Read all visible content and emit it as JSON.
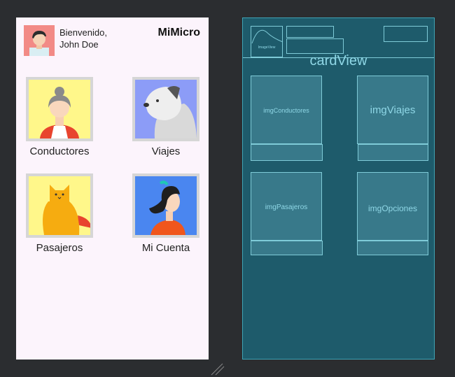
{
  "header": {
    "greeting_line1": "Bienvenido,",
    "greeting_line2": "John Doe",
    "app_title": "MiMicro"
  },
  "tiles": [
    {
      "label": "Conductores",
      "icon": "grandma-icon"
    },
    {
      "label": "Viajes",
      "icon": "dog-icon"
    },
    {
      "label": "Pasajeros",
      "icon": "cat-icon"
    },
    {
      "label": "Mi Cuenta",
      "icon": "girl-icon"
    }
  ],
  "blueprint": {
    "header_image_label": "ImageView",
    "card_view_label": "cardView",
    "cards": [
      {
        "label": "imgConductores"
      },
      {
        "label": "imgViajes"
      },
      {
        "label": "imgPasajeros"
      },
      {
        "label": "imgOpciones"
      }
    ]
  },
  "colors": {
    "phone_background": "#fcf4fc",
    "blueprint_background": "#1e5b6b",
    "blueprint_stroke": "#7fcbd8"
  }
}
